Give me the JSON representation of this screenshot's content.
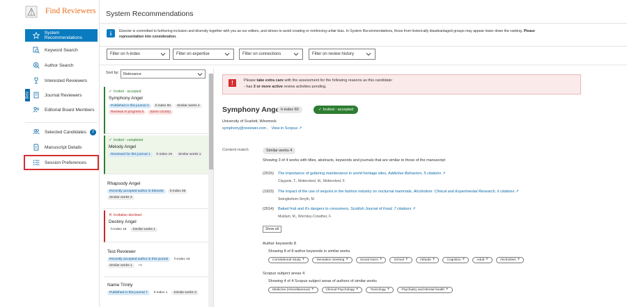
{
  "app": {
    "title": "Find Reviewers"
  },
  "nav": {
    "items": [
      {
        "label": "System Recommendations",
        "icon": "star-icon"
      },
      {
        "label": "Keyword Search",
        "icon": "keyword-search-icon"
      },
      {
        "label": "Author Search",
        "icon": "author-search-icon"
      },
      {
        "label": "Interested Reviewers",
        "icon": "interested-reviewer-icon"
      },
      {
        "label": "Journal Reviewers",
        "icon": "journal-icon"
      },
      {
        "label": "Editorial Board Members",
        "icon": "board-members-icon"
      },
      {
        "label": "Selected Candidates",
        "icon": "selected-candidates-icon",
        "badge": "2"
      },
      {
        "label": "Manuscript Details",
        "icon": "manuscript-icon"
      },
      {
        "label": "Session Preferences",
        "icon": "preferences-list-icon"
      }
    ],
    "side_tab": "Beta"
  },
  "page": {
    "title": "System Recommendations",
    "info_line1": "Elsevier is committed to furthering inclusion and diversity together with you as our editors, and strives to avoid creating or reinforcing unfair bias. In System Recommendations, those from historically disadvantaged groups may appear lower down the ranking. ",
    "info_bold1": "Please",
    "info_bold2": "representation into consideration."
  },
  "filters": [
    {
      "label": "Filter on h-index"
    },
    {
      "label": "Filter on expertise"
    },
    {
      "label": "Filter on connections"
    },
    {
      "label": "Filter on review history"
    }
  ],
  "sort": {
    "label": "Sort by:",
    "value": "Relevance"
  },
  "candidates": [
    {
      "status": "Invited - accepted",
      "name": "Symphony Angel",
      "tags": [
        "Published in this journal 3",
        "h-index 60",
        "Similar works 4",
        "Reviews in progress 6",
        "Same country"
      ]
    },
    {
      "status": "Invited - completed",
      "name": "Melody Angel",
      "tags": [
        "Reviewed for this journal 1",
        "h-index 19",
        "Similar works 1"
      ]
    },
    {
      "status": "",
      "name": "Rhapsody Angel",
      "tags": [
        "Recently accepted author in Elsevier",
        "h-index 39",
        "Similar works 3"
      ]
    },
    {
      "status": "Invitation declined",
      "name": "Destiny Angel",
      "tags": [
        "h-index 19",
        "Similar works 1"
      ]
    },
    {
      "status": "",
      "name": "Test Reviewer",
      "tags": [
        "Recently accepted author in this journal",
        "h-index 19",
        "Similar works 1",
        "+1"
      ]
    },
    {
      "status": "",
      "name": "Name Trinity",
      "tags": [
        "Published in this journal 7",
        "h-index 1",
        "Similar works 3"
      ]
    }
  ],
  "alert": {
    "prefix": "Please ",
    "bold": "take extra care",
    "suffix": " with the assessment for the following reasons as this candidate:",
    "line2_prefix": "- has ",
    "line2_bold": "3 or more active",
    "line2_suffix": " review activities pending."
  },
  "detail": {
    "name": "Symphony Angel",
    "hindex": "h-index 60",
    "status": "Invited - accepted",
    "affiliation": "University of Scarlett, Wiremock",
    "email": "symphony@reviewer.com ,",
    "scopus_link": "View in Scopus ↗",
    "content_match_label": "Content match",
    "similar_works_pill": "Similar works 4",
    "showing_text": "Showing 3 of 4 works with titles, abstracts, keywords and journals that are similar to those of the manuscript",
    "works": [
      {
        "year": "(2015)",
        "title": "The importance of guttering maintenance in world heritage sites, ",
        "journal": "Addictive Behaviors, 5 citations ↗",
        "authors": "Claypole, T., Mottershed, M., Mottershed, F."
      },
      {
        "year": "(1923)",
        "title": "The impact of the use of sequins in the fashion industry on nocturnal mammals, ",
        "journal": "Alcoholism: Clinical and Experimental Research, 6 citations ↗",
        "authors": "Swingbottom-Smyth, M."
      },
      {
        "year": "(2014)",
        "title": "Baked fruit and it's dangers to consumers, ",
        "journal": "Scottish Journal of Food, 7 citations ↗",
        "authors": "Muldam, M., Wormley-Crowther, F."
      }
    ],
    "show_all": "Show all",
    "author_keywords": {
      "title": "Author keywords 8",
      "sub": "Showing 8 of 8 author keywords in similar works",
      "items": [
        "Correlational Study",
        "Sensation Seeking",
        "Social Norm",
        "School",
        "Attitude",
        "Cognition",
        "Adult",
        "Alcoholism"
      ]
    },
    "subject_areas": {
      "title": "Scopus subject areas 4",
      "sub": "Showing 4 of 4 Scopus subject areas of authors of similar works",
      "items": [
        "Medicine (miscellaneous)",
        "Clinical Psychology",
        "Toxicology",
        "Psychiatry and Mental health"
      ]
    }
  },
  "colors": {
    "accent": "#0a7bbf",
    "brand_orange": "#e9711c",
    "success": "#2e7d32",
    "danger": "#d32f2f"
  }
}
